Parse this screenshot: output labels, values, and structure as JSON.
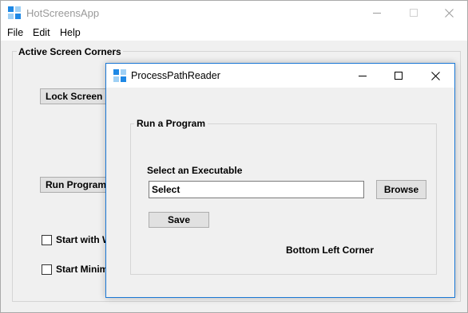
{
  "main_window": {
    "title": "HotScreensApp",
    "menu": [
      "File",
      "Edit",
      "Help"
    ],
    "group_label": "Active Screen Corners",
    "buttons": {
      "lock_screen": "Lock Screen",
      "run_program": "Run Program"
    },
    "checkboxes": [
      {
        "label": "Start with W",
        "checked": false
      },
      {
        "label": "Start Minim",
        "checked": false
      }
    ]
  },
  "dialog": {
    "title": "ProcessPathReader",
    "group_label": "Run a Program",
    "select_label": "Select an Executable",
    "path_input_value": "Select",
    "browse_label": "Browse",
    "save_label": "Save",
    "corner_label": "Bottom Left Corner"
  },
  "icons": {
    "app": "app-tiles-icon",
    "minimize": "minimize-icon",
    "maximize": "maximize-icon",
    "close": "close-icon"
  },
  "colors": {
    "app_icon_dark": "#1e88e5",
    "app_icon_light": "#9fd0f5",
    "dialog_border": "#1a78d6",
    "client_bg": "#f0f0f0",
    "button_bg": "#e1e1e1"
  }
}
